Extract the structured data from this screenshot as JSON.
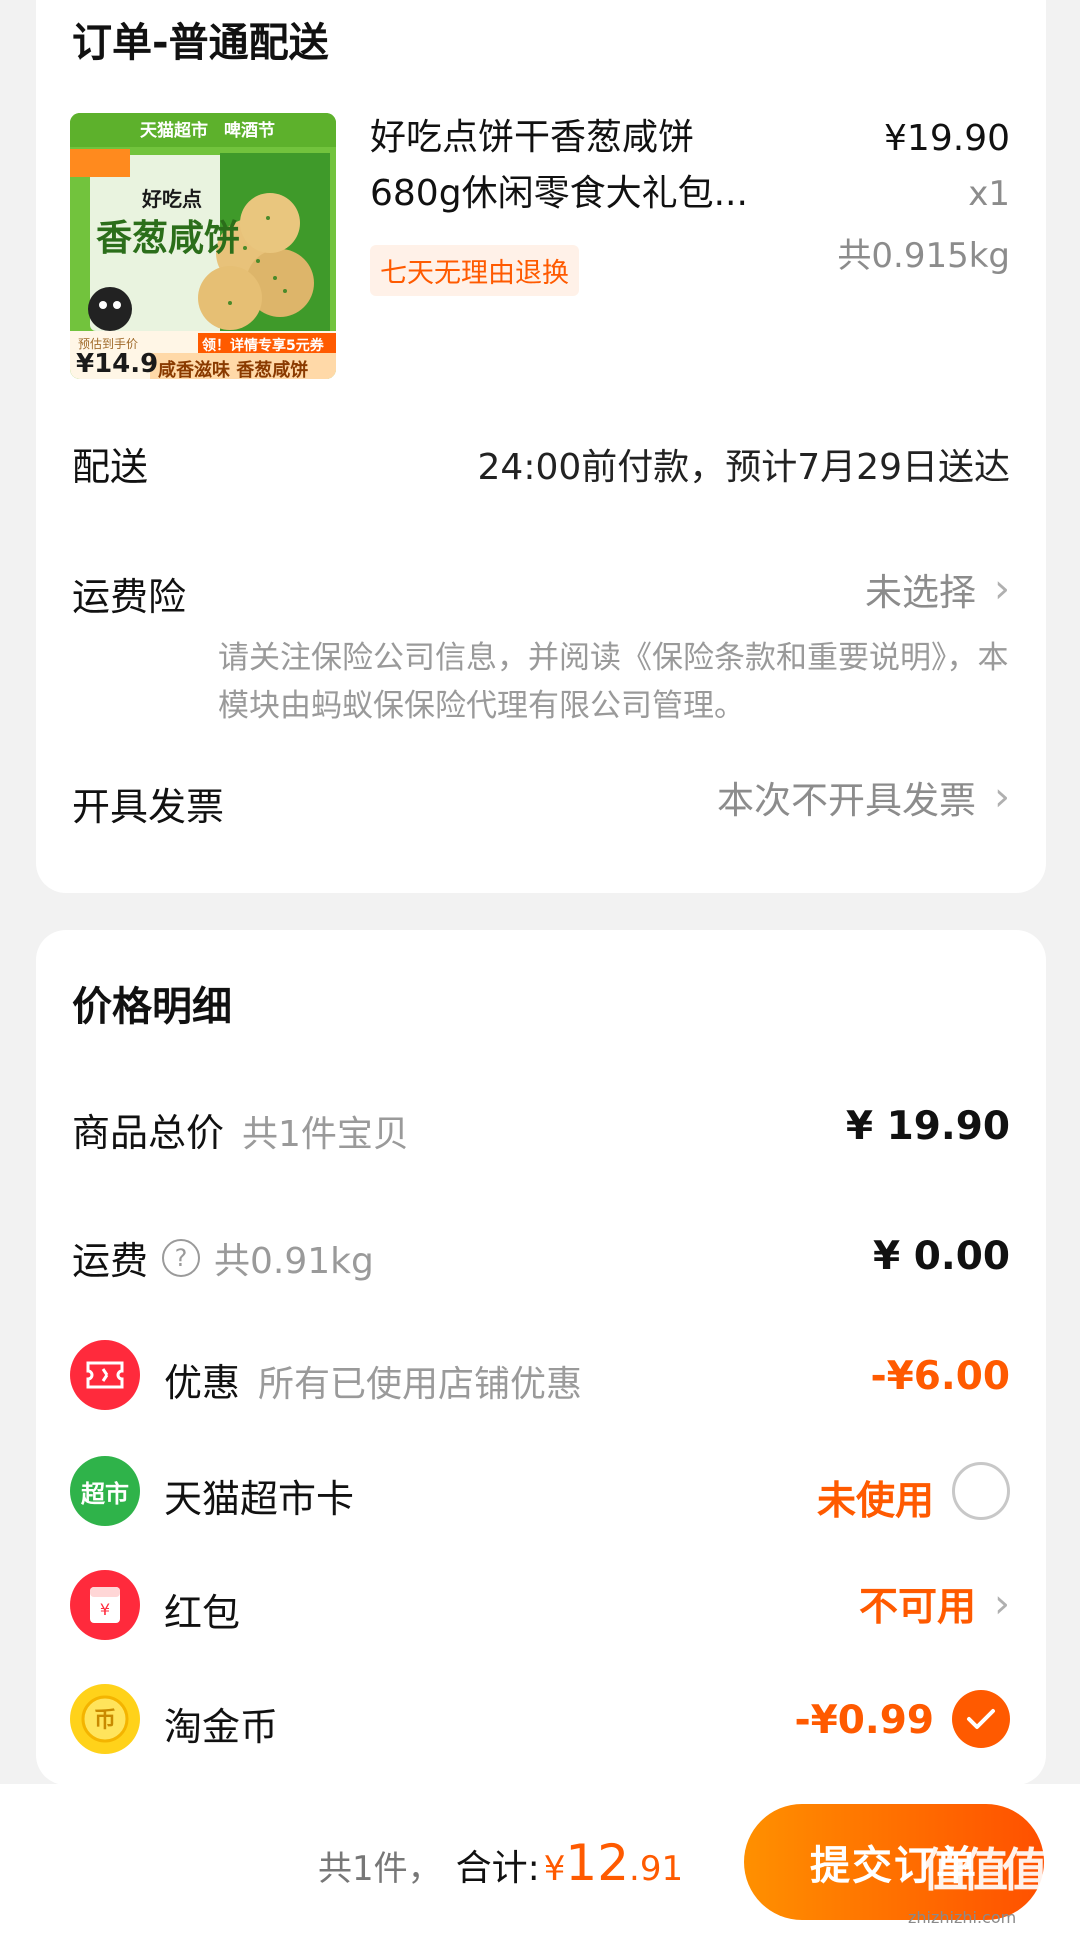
{
  "order": {
    "title": "订单-普通配送",
    "product": {
      "name_line1": "好吃点饼干香葱咸饼",
      "name_line2": "680g休闲零食大礼包...",
      "price": "¥19.90",
      "qty": "x1",
      "weight": "共0.915kg",
      "tag": "七天无理由退换",
      "image_text": {
        "store": "天猫超市",
        "festival": "啤酒节",
        "brand": "好吃点",
        "product": "香葱咸饼",
        "promo": "领！详情专享5元券",
        "est_label": "预估到手价",
        "est_price": "¥14.9",
        "slogan": "咸香滋味 香葱咸饼"
      }
    },
    "delivery": {
      "label": "配送",
      "value": "24:00前付款，预计7月29日送达"
    },
    "insurance": {
      "label": "运费险",
      "value": "未选择",
      "note": "请关注保险公司信息，并阅读《保险条款和重要说明》，本模块由蚂蚁保保险代理有限公司管理。"
    },
    "invoice": {
      "label": "开具发票",
      "value": "本次不开具发票"
    }
  },
  "price": {
    "title": "价格明细",
    "goods": {
      "label": "商品总价",
      "sub": "共1件宝贝",
      "value": "¥ 19.90"
    },
    "shipping": {
      "label": "运费",
      "sub": "共0.91kg",
      "value": "¥ 0.00"
    },
    "discount": {
      "label": "优惠",
      "sub": "所有已使用店铺优惠",
      "value": "-¥6.00"
    },
    "card": {
      "label": "天猫超市卡",
      "value": "未使用",
      "icon_text": "超市"
    },
    "redpacket": {
      "label": "红包",
      "value": "不可用"
    },
    "coin": {
      "label": "淘金币",
      "value": "-¥0.99"
    }
  },
  "bottom": {
    "count": "共1件，",
    "total_label": "合计:",
    "currency": "¥",
    "total_int": "12",
    "total_dec": ".91",
    "submit": "提交订单"
  },
  "watermark": {
    "logo": "值值值",
    "url": "zhizhizhi.com"
  },
  "colors": {
    "accent": "#ff5a00",
    "button_start": "#ff9000",
    "button_end": "#ff5000",
    "product_green": "#6fc13a"
  }
}
